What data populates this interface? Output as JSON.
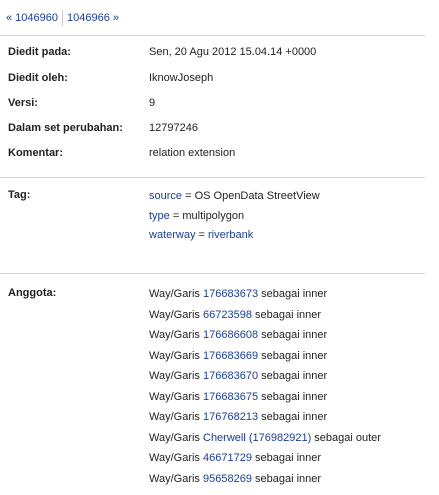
{
  "nav": {
    "prev": "« 1046960",
    "next": "1046966 »"
  },
  "details": {
    "edited_at_label": "Diedit pada:",
    "edited_at_value": "Sen, 20 Agu 2012 15.04.14 +0000",
    "edited_by_label": "Diedit oleh:",
    "edited_by_value": "IknowJoseph",
    "version_label": "Versi:",
    "version_value": "9",
    "changeset_label": "Dalam set perubahan:",
    "changeset_value": "12797246",
    "comment_label": "Komentar:",
    "comment_value": "relation extension"
  },
  "tags": {
    "label": "Tag:",
    "items": [
      {
        "key": "source",
        "eq": " = ",
        "value": "OS OpenData StreetView",
        "value_link": false
      },
      {
        "key": "type",
        "eq": " = ",
        "value": "multipolygon",
        "value_link": false
      },
      {
        "key": "waterway",
        "eq": " = ",
        "value": "riverbank",
        "value_link": true
      }
    ]
  },
  "members": {
    "label": "Anggota:",
    "items": [
      {
        "prefix": "Way/Garis ",
        "link": "176683673",
        "suffix": " sebagai inner"
      },
      {
        "prefix": "Way/Garis ",
        "link": "66723598",
        "suffix": " sebagai inner"
      },
      {
        "prefix": "Way/Garis ",
        "link": "176686608",
        "suffix": " sebagai inner"
      },
      {
        "prefix": "Way/Garis ",
        "link": "176683669",
        "suffix": " sebagai inner"
      },
      {
        "prefix": "Way/Garis ",
        "link": "176683670",
        "suffix": " sebagai inner"
      },
      {
        "prefix": "Way/Garis ",
        "link": "176683675",
        "suffix": " sebagai inner"
      },
      {
        "prefix": "Way/Garis ",
        "link": "176768213",
        "suffix": " sebagai inner"
      },
      {
        "prefix": "Way/Garis ",
        "link": "Cherwell (176982921)",
        "suffix": " sebagai outer"
      },
      {
        "prefix": "Way/Garis ",
        "link": "46671729",
        "suffix": " sebagai inner"
      },
      {
        "prefix": "Way/Garis ",
        "link": "95658269",
        "suffix": " sebagai inner"
      }
    ]
  },
  "colors": {
    "link": "#1a3e9b",
    "divider": "#d6d6d6",
    "text": "#222222"
  }
}
